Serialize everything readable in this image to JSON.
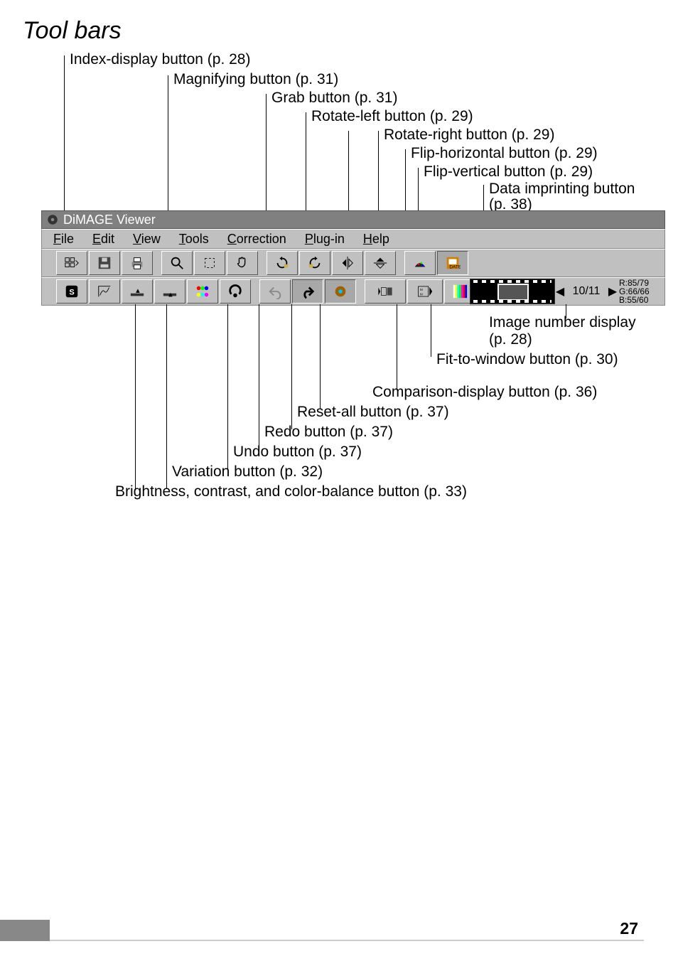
{
  "page_title": "Tool bars",
  "page_number": "27",
  "top_callouts": {
    "index_display": "Index-display button (p. 28)",
    "magnifying": "Magnifying button (p. 31)",
    "grab": "Grab button (p. 31)",
    "rotate_left": "Rotate-left button (p. 29)",
    "rotate_right": "Rotate-right button (p. 29)",
    "flip_horizontal": "Flip-horizontal button (p. 29)",
    "flip_vertical": "Flip-vertical button (p. 29)",
    "data_imprint_line1": "Data imprinting button",
    "data_imprint_line2": "(p. 38)"
  },
  "window": {
    "title": "DiMAGE Viewer",
    "menus": {
      "file": "File",
      "edit": "Edit",
      "view": "View",
      "tools": "Tools",
      "correction": "Correction",
      "plugin": "Plug-in",
      "help": "Help"
    }
  },
  "image_indicator": {
    "current": "10/11"
  },
  "rgb": {
    "r": "R:85/79",
    "g": "G:66/66",
    "b": "B:55/60"
  },
  "bottom_callouts": {
    "image_number_line1": "Image number display",
    "image_number_line2": "(p. 28)",
    "fit_to_window": "Fit-to-window button (p. 30)",
    "comparison": "Comparison-display button (p. 36)",
    "reset_all": "Reset-all button (p. 37)",
    "redo": "Redo button (p. 37)",
    "undo": "Undo button (p. 37)",
    "variation": "Variation button (p. 32)",
    "brightness": "Brightness, contrast, and color-balance button (p. 33)"
  }
}
